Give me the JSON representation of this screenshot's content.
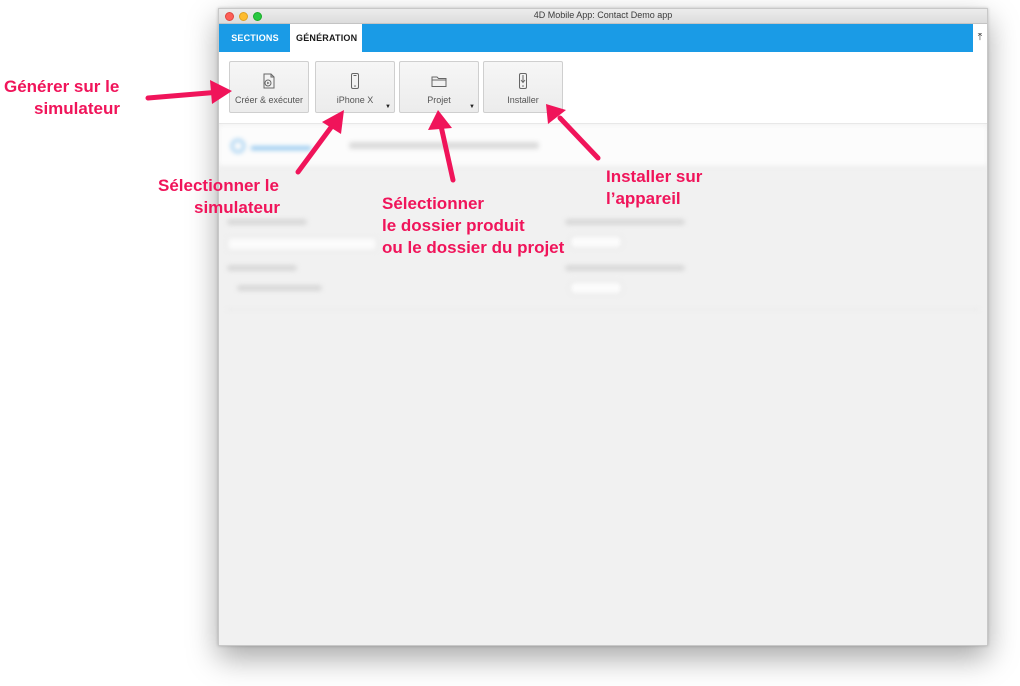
{
  "window": {
    "title": "4D Mobile App: Contact Demo app"
  },
  "tabs": {
    "sections": "SECTIONS",
    "generation": "GÉNÉRATION",
    "upload_icon": "upload-icon"
  },
  "toolbar": {
    "build_run_label": "Créer & exécuter",
    "simulator_label": "iPhone X",
    "project_label": "Projet",
    "install_label": "Installer"
  },
  "annotations": {
    "generate_line1": "Générer sur le",
    "generate_line2": "simulateur",
    "select_sim_line1": "Sélectionner le",
    "select_sim_line2": "simulateur",
    "select_folder_line1": "Sélectionner",
    "select_folder_line2": "le dossier produit",
    "select_folder_line3": "ou le dossier du projet",
    "install_line1": "Installer sur",
    "install_line2": "l’appareil"
  },
  "colors": {
    "accent": "#1a9be6",
    "annotation": "#f0145a"
  }
}
